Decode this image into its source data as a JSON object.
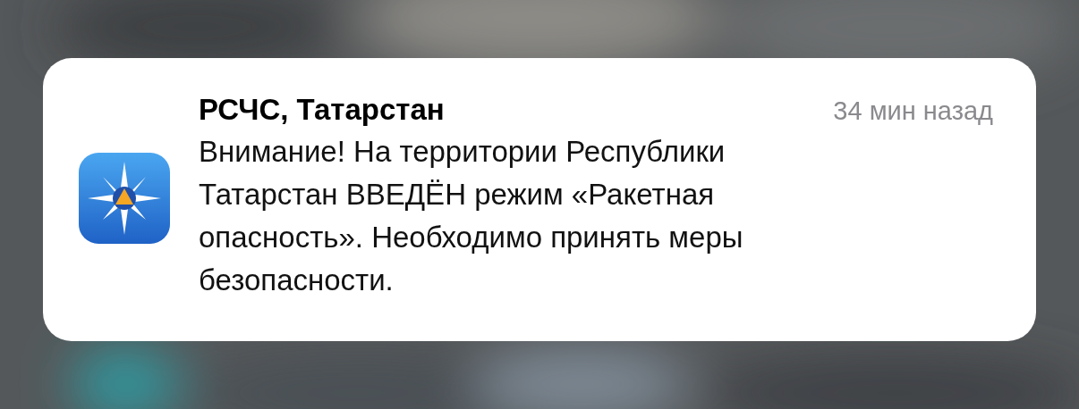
{
  "notification": {
    "app_name": "РСЧС, Татарстан",
    "time": "34 мин назад",
    "lines": [
      "Внимание! На территории Республики",
      "Татарстан ВВЕДЁН режим «Ракетная",
      "опасность». Необходимо принять меры",
      "безопасности."
    ]
  }
}
